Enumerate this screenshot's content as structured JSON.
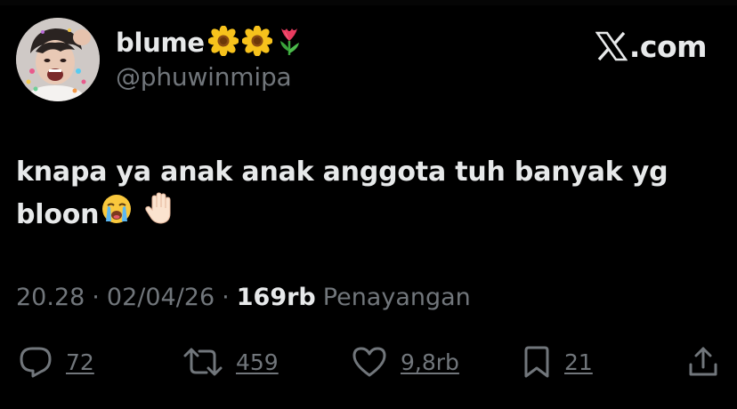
{
  "author": {
    "display_name": "blume",
    "name_emojis": [
      "sunflower-emoji",
      "sunflower-emoji",
      "tulip-emoji"
    ],
    "handle": "@phuwinmipa"
  },
  "brand": {
    "x_icon": "x-logo-icon",
    "domain": ".com"
  },
  "tweet": {
    "line1": "knapa ya anak anak anggota tuh banyak yg",
    "line2": "bloon",
    "line2_emojis": [
      "loudly-crying-face-emoji",
      "raised-hand-emoji"
    ]
  },
  "meta": {
    "time": "20.28",
    "separator": "·",
    "date": "02/04/26",
    "views_count": "169rb",
    "views_label": "Penayangan"
  },
  "actions": {
    "reply": {
      "icon": "reply-icon",
      "count": "72"
    },
    "retweet": {
      "icon": "retweet-icon",
      "count": "459"
    },
    "like": {
      "icon": "heart-icon",
      "count": "9,8rb"
    },
    "bookmark": {
      "icon": "bookmark-icon",
      "count": "21"
    },
    "share": {
      "icon": "share-icon"
    }
  },
  "colors": {
    "background": "#000000",
    "primary_text": "#e7e9ea",
    "secondary_text": "#71767b"
  }
}
